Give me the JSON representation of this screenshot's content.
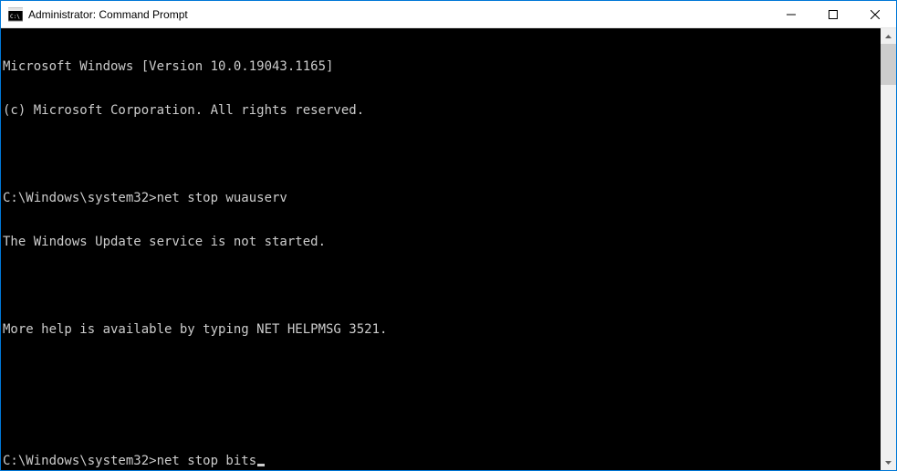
{
  "window": {
    "title": "Administrator: Command Prompt"
  },
  "terminal": {
    "lines": [
      "Microsoft Windows [Version 10.0.19043.1165]",
      "(c) Microsoft Corporation. All rights reserved.",
      "",
      "C:\\Windows\\system32>net stop wuauserv",
      "The Windows Update service is not started.",
      "",
      "More help is available by typing NET HELPMSG 3521.",
      "",
      "",
      "C:\\Windows\\system32>net stop bits"
    ],
    "prompt": "C:\\Windows\\system32>",
    "commands": [
      "net stop wuauserv",
      "net stop bits"
    ]
  },
  "colors": {
    "accent": "#0078d7",
    "terminal_bg": "#000000",
    "terminal_fg": "#cccccc"
  }
}
